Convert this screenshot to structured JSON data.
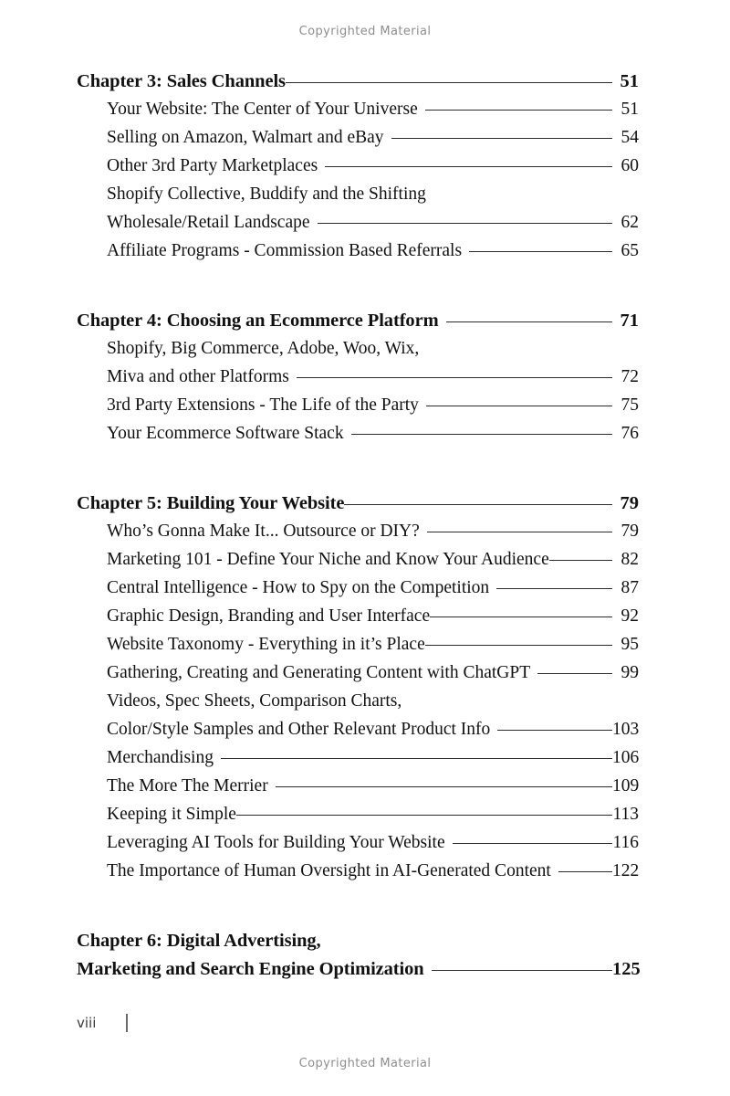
{
  "watermark": {
    "top": "Copyrighted Material",
    "bottom": "Copyrighted Material"
  },
  "footer": {
    "folio": "viii"
  },
  "toc": {
    "chapters": [
      {
        "heading": "Chapter 3: Sales Channels",
        "heading_page": "51",
        "heading_leader": true,
        "heading_gap": false,
        "entries": [
          {
            "label": "Your Website: The Center of Your Universe",
            "page": "51",
            "leader": true,
            "gap": true
          },
          {
            "label": "Selling on Amazon, Walmart and eBay",
            "page": "54",
            "leader": true,
            "gap": true
          },
          {
            "label": "Other 3rd Party Marketplaces",
            "page": "60",
            "leader": true,
            "gap": true
          },
          {
            "label": "Shopify Collective, Buddify and the Shifting",
            "page": "",
            "leader": false,
            "gap": true
          },
          {
            "label": "Wholesale/Retail Landscape",
            "page": "62",
            "leader": true,
            "gap": true
          },
          {
            "label": "Affiliate Programs - Commission Based Referrals",
            "page": "65",
            "leader": true,
            "gap": true
          }
        ]
      },
      {
        "heading": "Chapter 4: Choosing an Ecommerce Platform",
        "heading_page": "71",
        "heading_leader": true,
        "heading_gap": true,
        "entries": [
          {
            "label": "Shopify, Big Commerce, Adobe, Woo, Wix,",
            "page": "",
            "leader": false,
            "gap": true
          },
          {
            "label": "Miva and other Platforms",
            "page": "72",
            "leader": true,
            "gap": true
          },
          {
            "label": "3rd Party Extensions - The Life of the Party",
            "page": "75",
            "leader": true,
            "gap": true
          },
          {
            "label": "Your Ecommerce Software Stack",
            "page": "76",
            "leader": true,
            "gap": true
          }
        ]
      },
      {
        "heading": "Chapter 5: Building Your Website",
        "heading_page": "79",
        "heading_leader": true,
        "heading_gap": false,
        "entries": [
          {
            "label": "Who’s Gonna Make It... Outsource or DIY?",
            "page": "79",
            "leader": true,
            "gap": true
          },
          {
            "label": "Marketing 101 - Define Your Niche  and Know Your Audience",
            "page": "82",
            "leader": true,
            "gap": false
          },
          {
            "label": "Central Intelligence - How to Spy on the Competition",
            "page": "87",
            "leader": true,
            "gap": true
          },
          {
            "label": "Graphic Design, Branding and User Interface",
            "page": "92",
            "leader": true,
            "gap": false
          },
          {
            "label": "Website Taxonomy - Everything in it’s Place",
            "page": "95",
            "leader": true,
            "gap": false
          },
          {
            "label": "Gathering, Creating and Generating Content with ChatGPT",
            "page": "99",
            "leader": true,
            "gap": true
          },
          {
            "label": "Videos, Spec Sheets, Comparison Charts,",
            "page": "",
            "leader": false,
            "gap": true
          },
          {
            "label": "Color/Style Samples and Other Relevant Product Info",
            "page": "103",
            "leader": true,
            "gap": true
          },
          {
            "label": "Merchandising",
            "page": "106",
            "leader": true,
            "gap": true
          },
          {
            "label": "The More The Merrier",
            "page": "109",
            "leader": true,
            "gap": true
          },
          {
            "label": "Keeping it Simple",
            "page": "113",
            "leader": true,
            "gap": false
          },
          {
            "label": "Leveraging AI Tools for Building Your Website",
            "page": "116",
            "leader": true,
            "gap": true
          },
          {
            "label": "The Importance of Human Oversight in AI-Generated Content",
            "page": "122",
            "leader": true,
            "gap": true
          }
        ]
      },
      {
        "heading": "Chapter 6: Digital Advertising,",
        "heading_page": "",
        "heading_leader": false,
        "heading_gap": false,
        "entries": [],
        "heading_continuation": "Marketing and Search Engine Optimization",
        "continuation_page": "125",
        "continuation_leader": true,
        "continuation_gap": true
      }
    ]
  }
}
